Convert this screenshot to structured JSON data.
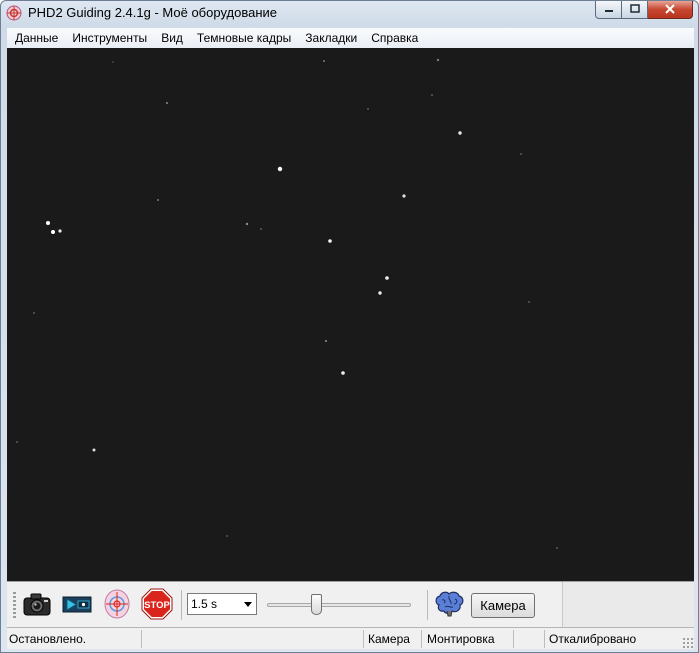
{
  "window": {
    "title": "PHD2 Guiding 2.4.1g - Моё оборудование",
    "controls": [
      "minimize-icon",
      "maximize-icon",
      "close-icon"
    ]
  },
  "menu": {
    "items": [
      "Данные",
      "Инструменты",
      "Вид",
      "Темновые кадры",
      "Закладки",
      "Справка"
    ]
  },
  "toolbar": {
    "buttons": [
      {
        "icon": "camera-icon",
        "name": "loop-exposure"
      },
      {
        "icon": "auto-select-star-icon",
        "name": "auto-select-star"
      },
      {
        "icon": "guide-target-icon",
        "name": "start-guiding"
      },
      {
        "icon": "stop-sign-icon",
        "name": "stop",
        "label": "STOP"
      }
    ],
    "exposure": "1.5 s",
    "gamma_slider_level": 0.33,
    "brain_icon": "brain-icon",
    "camera_button_label": "Камера"
  },
  "status": {
    "message": "Остановлено.",
    "camera": "Камера",
    "mount": "Монтировка",
    "calibration": "Откалибровано"
  },
  "colors": {
    "sky_background": "#1a1a1a",
    "star": "#ffffff",
    "stop_red": "#d9251c"
  }
}
